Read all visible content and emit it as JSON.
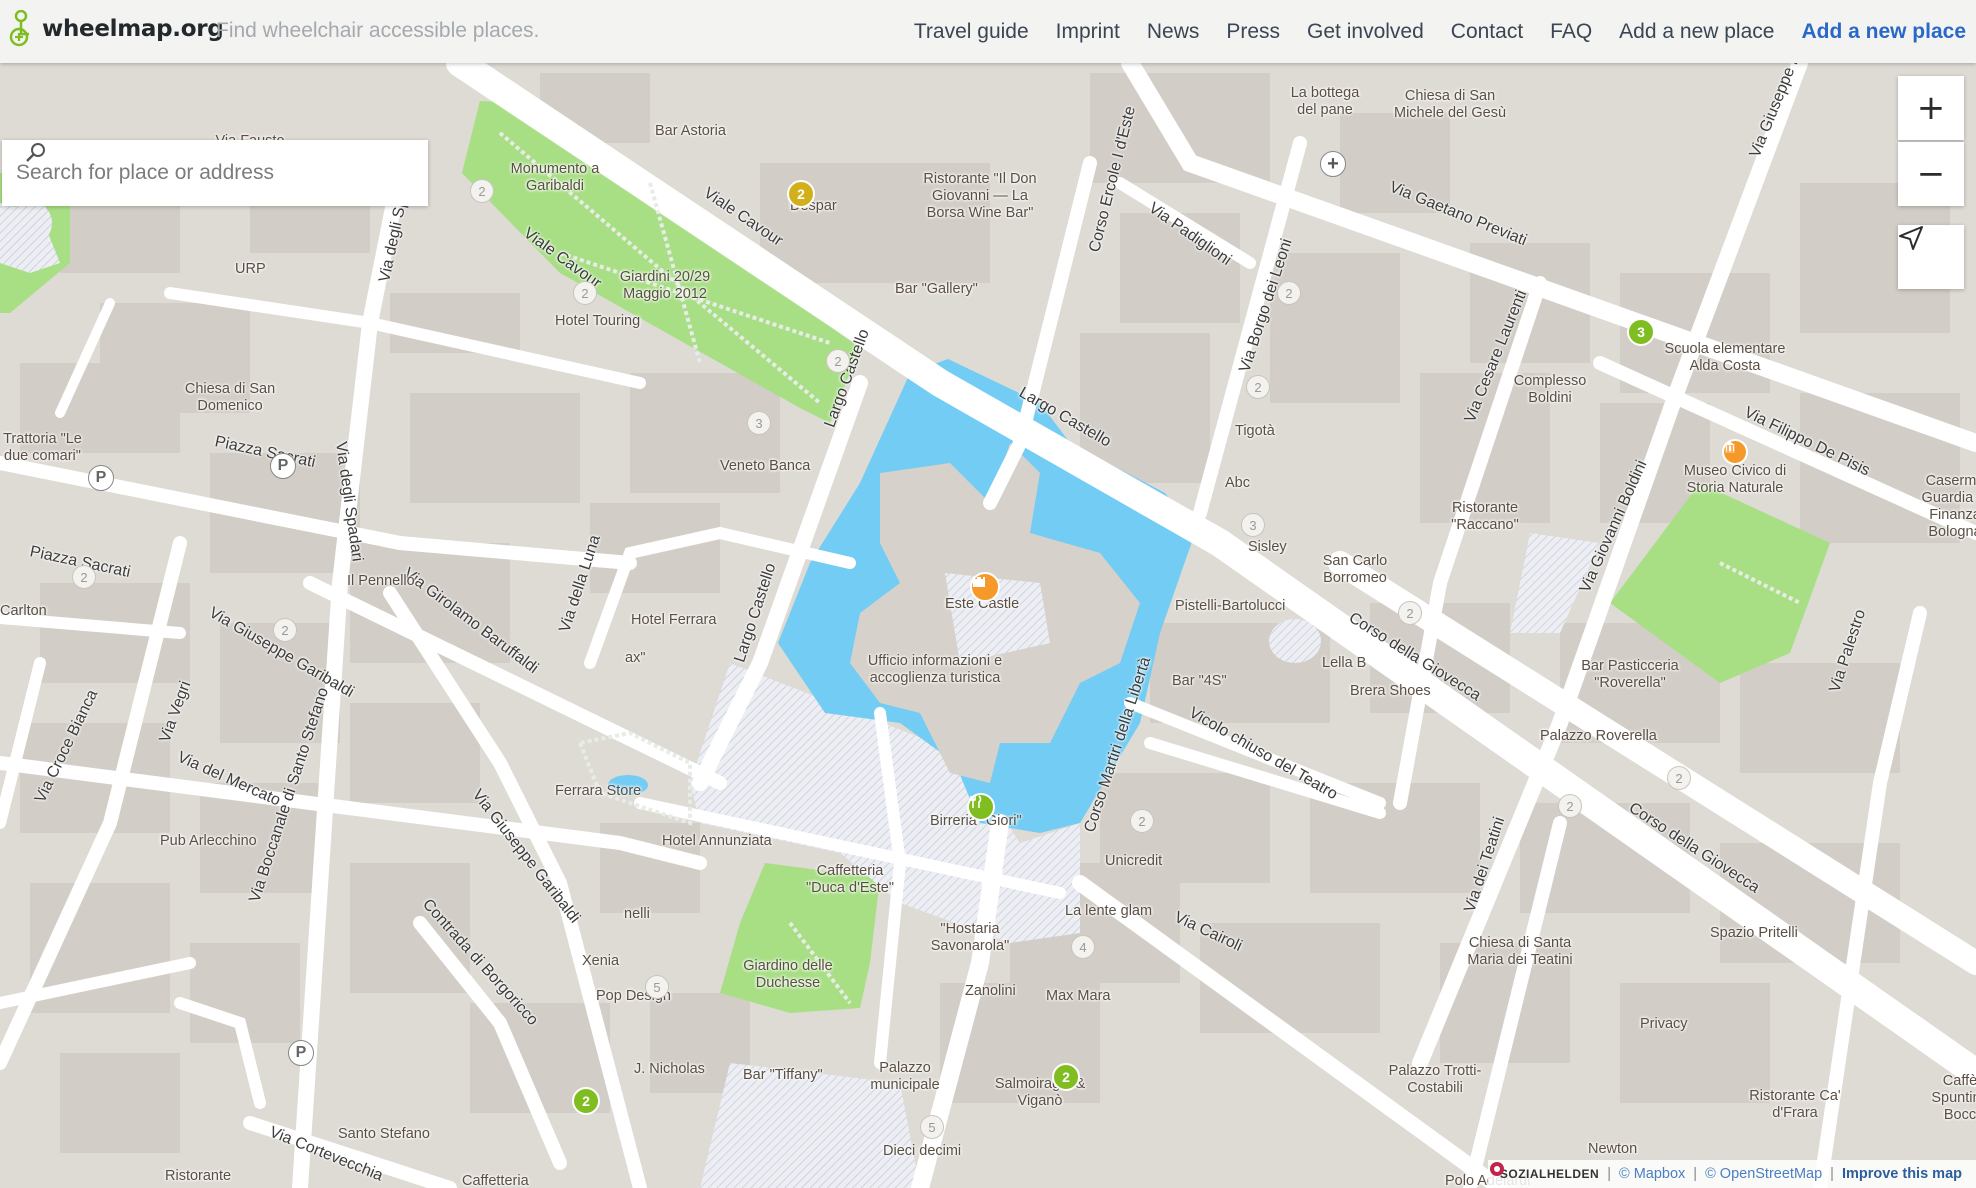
{
  "brand": {
    "logo_text": "wheelmap.org",
    "tagline": "Find wheelchair accessible places."
  },
  "nav": [
    {
      "label": "Travel guide"
    },
    {
      "label": "Imprint"
    },
    {
      "label": "News"
    },
    {
      "label": "Press"
    },
    {
      "label": "Get involved"
    },
    {
      "label": "Contact"
    },
    {
      "label": "FAQ"
    },
    {
      "label": "Add a new place"
    },
    {
      "label": "Add a new place",
      "primary": true
    }
  ],
  "search": {
    "placeholder": "Search for place or address"
  },
  "controls": {
    "zoom_in": "+",
    "zoom_out": "−"
  },
  "attribution": {
    "brand": "SOZIALHELDEN",
    "mapbox": "© Mapbox",
    "osm": "© OpenStreetMap",
    "improve": "Improve this map"
  },
  "map": {
    "streets": [
      "Viale Cavour",
      "Viale Cavour",
      "Largo Castello",
      "Largo Castello",
      "Corso Ercole I d'Este",
      "Via Padiglioni",
      "Via Borgo dei Leoni",
      "Via Gaetano Previati",
      "Via Cesare Laurenti",
      "Via Filippo De Pisis",
      "Via Giovanni Boldini",
      "Corso della Giovecca",
      "Corso della Giovecca",
      "Via Palestro",
      "Via degli Spadari",
      "Via degli Spadari",
      "Piazza Sacrati",
      "Piazza Sacrati",
      "Via Girolamo Baruffaldi",
      "Via della Luna",
      "Largo Castello",
      "Via Giuseppe Garibaldi",
      "Via Vegri",
      "Via Croce Bianca",
      "Via del Mercato",
      "Via Boccanale di Santo Stefano",
      "Via Giuseppe Garibaldi",
      "Contrada di Borgoricco",
      "Corso Martiri della Libertà",
      "Vicolo chiuso del Teatro",
      "Via Cairoli",
      "Via dei Teatini",
      "Via Cortevecchia",
      "Via Giuseppe Mentessi"
    ],
    "places": [
      "Bar Astoria",
      "Monumento a Garibaldi",
      "Via Fausto Beretta",
      "URP",
      "Giardini 20/29 Maggio 2012",
      "Hotel Touring",
      "Despar",
      "Ristorante \"Il Don Giovanni — La Borsa Wine Bar\"",
      "Bar \"Gallery\"",
      "La bottega del pane",
      "Chiesa di San Michele del Gesù",
      "Scuola elementare Alda Costa",
      "Complesso Boldini",
      "Museo Civico di Storia Naturale",
      "Caserma Guardia di Finanza Bologna",
      "Tigotà",
      "Abc",
      "Sisley",
      "San Carlo Borromeo",
      "Ristorante \"Raccano\"",
      "Pistelli-Bartolucci",
      "Lella B",
      "Brera Shoes",
      "Bar Pasticceria \"Roverella\"",
      "Palazzo Roverella",
      "Chiesa di San Domenico",
      "Trattoria \"Le due comari\"",
      "Veneto Banca",
      "Il Pennello",
      "Carlton",
      "Hotel Ferrara",
      "Este Castle",
      "Ufficio informazioni e accoglienza turistica",
      "Bar \"4S\"",
      "Ferrara Store",
      "Hotel Annunziata",
      "Birreria \"Giori\"",
      "Unicredit",
      "Caffetteria \"Duca d'Este\"",
      "Pub Arlecchino",
      "Giardino delle Duchesse",
      "Xenia",
      "Pop Design",
      "\"Hostaria Savonarola\"",
      "Zanolini",
      "La lente glam",
      "Max Mara",
      "Chiesa di Santa Maria dei Teatini",
      "Spazio Pritelli",
      "Privacy",
      "Palazzo Trotti-Costabili",
      "Ristorante Ca' d'Frara",
      "Caffè Spuntino Bocc",
      "J. Nicholas",
      "Bar \"Tiffany\"",
      "Palazzo municipale",
      "Salmoiraghi & Viganò",
      "Santo Stefano",
      "Dieci decimi",
      "Newton",
      "Ristorante",
      "Caffetteria",
      "Polo Adelardi",
      "nelli",
      "ax\""
    ],
    "clusters": [
      "2",
      "2",
      "3",
      "2",
      "2",
      "2",
      "2",
      "3",
      "2",
      "2",
      "2",
      "2",
      "2",
      "2",
      "2",
      "4",
      "5",
      "5",
      "3",
      "2"
    ]
  }
}
